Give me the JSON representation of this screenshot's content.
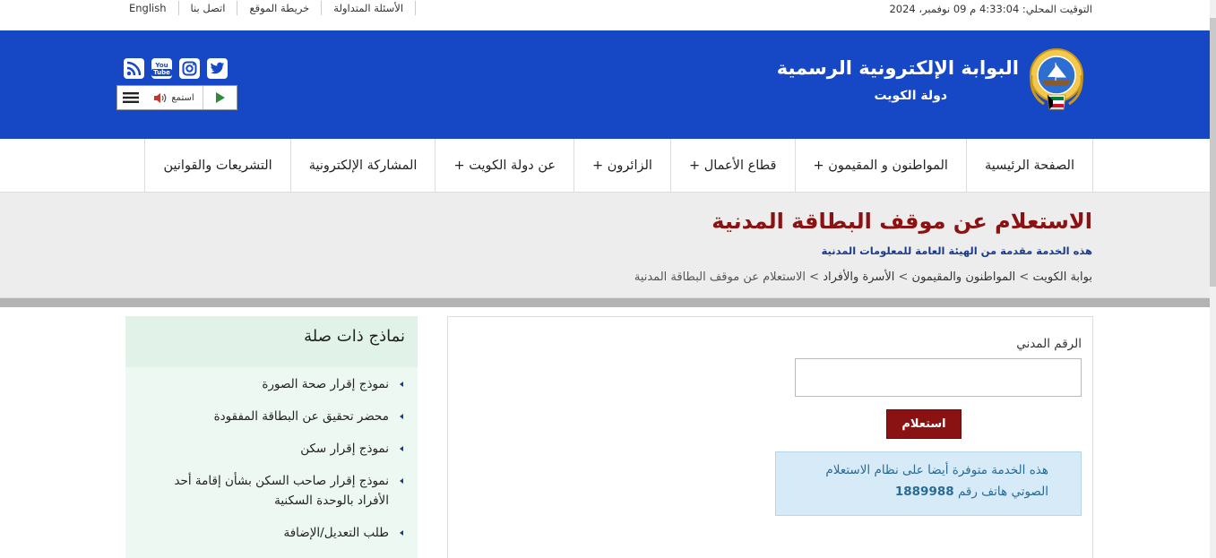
{
  "topbar": {
    "clock": "التوقيت المحلي: 4:33:04 م 09 نوفمبر، 2024",
    "links": [
      "English",
      "اتصل بنا",
      "خريطة الموقع",
      "الأسئلة المتداولة"
    ]
  },
  "header": {
    "title": "البوابة الإلكترونية الرسمية",
    "subtitle": "دولة الكويت",
    "listen_label": "استمع",
    "socials": [
      "twitter-icon",
      "instagram-icon",
      "youtube-icon",
      "rss-icon"
    ],
    "youtube_text_1": "You",
    "youtube_text_2": "Tube"
  },
  "nav": {
    "items": [
      "الصفحة الرئيسية",
      "المواطنون و المقيمون +",
      "قطاع الأعمال +",
      "الزائرون +",
      "عن دولة الكويت +",
      "المشاركة الإلكترونية",
      "التشريعات والقوانين"
    ]
  },
  "page": {
    "title": "الاستعلام عن موقف البطاقة المدنية",
    "provider": "هذه الخدمة مقدمة من الهيئة العامة للمعلومات المدنية",
    "breadcrumb": [
      "بوابة الكويت",
      "المواطنون والمقيمون",
      "الأسرة والأفراد",
      "الاستعلام عن موقف البطاقة المدنية"
    ],
    "separator": ">"
  },
  "form": {
    "civil_id_label": "الرقم المدني",
    "civil_id_value": "",
    "submit_label": "استعلام",
    "info_text": "هذه الخدمة متوفرة أيضا على نظام الاستعلام الصوتي هاتف رقم",
    "info_number": "1889988"
  },
  "related": {
    "heading": "نماذج ذات صلة",
    "items": [
      "نموذج إقرار صحة الصورة",
      "محضر تحقيق عن البطاقة المفقودة",
      "نموذج إقرار سكن",
      "نموذج إقرار صاحب السكن بشأن إقامة أحد الأفراد بالوحدة السكنية",
      "طلب التعديل/الإضافة"
    ]
  },
  "colors": {
    "header_blue": "#1647c5",
    "title_red": "#8b1212",
    "button_red": "#8b1212",
    "info_bg": "#d6ebf7"
  }
}
